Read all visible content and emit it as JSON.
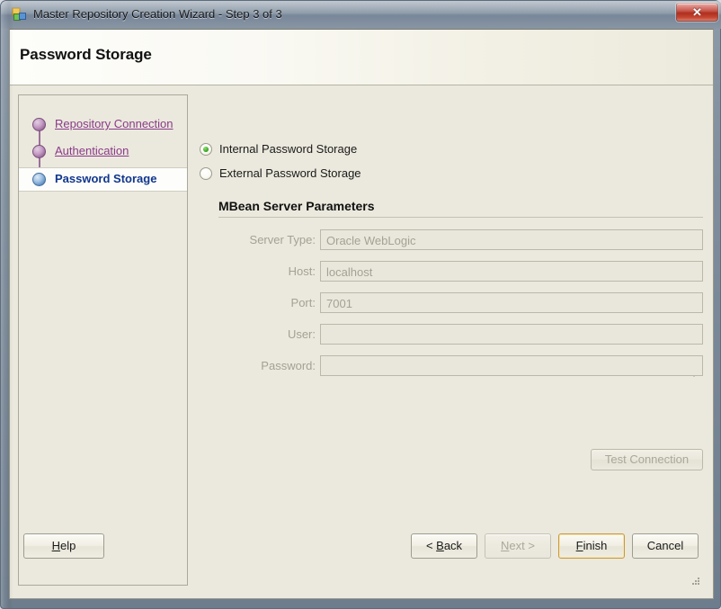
{
  "window": {
    "title": "Master Repository Creation Wizard - Step 3 of 3",
    "icon": "repository-wizard-icon",
    "close_label": "✕"
  },
  "header": {
    "page_title": "Password Storage"
  },
  "sidebar": {
    "items": [
      {
        "label": "Repository Connection",
        "state": "done"
      },
      {
        "label": "Authentication",
        "state": "done"
      },
      {
        "label": "Password Storage",
        "state": "current"
      }
    ]
  },
  "main": {
    "storage_options": [
      {
        "label": "Internal Password Storage",
        "selected": true
      },
      {
        "label": "External Password Storage",
        "selected": false
      }
    ],
    "group_title": "MBean Server Parameters",
    "fields": [
      {
        "label": "Server Type:",
        "value": "Oracle WebLogic",
        "type": "combo",
        "disabled": true
      },
      {
        "label": "Host:",
        "value": "localhost",
        "type": "text",
        "disabled": true
      },
      {
        "label": "Port:",
        "value": "7001",
        "type": "text",
        "disabled": true
      },
      {
        "label": "User:",
        "value": "",
        "type": "text",
        "disabled": true
      },
      {
        "label": "Password:",
        "value": "",
        "type": "password",
        "disabled": true
      }
    ],
    "test_connection_label": "Test Connection"
  },
  "footer": {
    "help": {
      "pre": "",
      "mnemonic": "H",
      "post": "elp"
    },
    "back": {
      "pre": "< ",
      "mnemonic": "B",
      "post": "ack"
    },
    "next": {
      "pre": "",
      "mnemonic": "N",
      "post": "ext >"
    },
    "finish": {
      "pre": "",
      "mnemonic": "F",
      "post": "inish"
    },
    "cancel": {
      "pre": "Cancel",
      "mnemonic": "",
      "post": ""
    }
  },
  "colors": {
    "accent_link": "#8a3a8a",
    "accent_current": "#10368e",
    "radio_selected": "#3fa82a",
    "default_button_ring": "#c79a3c",
    "close_button": "#bc3a2c",
    "client_bg": "#ebe9dd"
  }
}
